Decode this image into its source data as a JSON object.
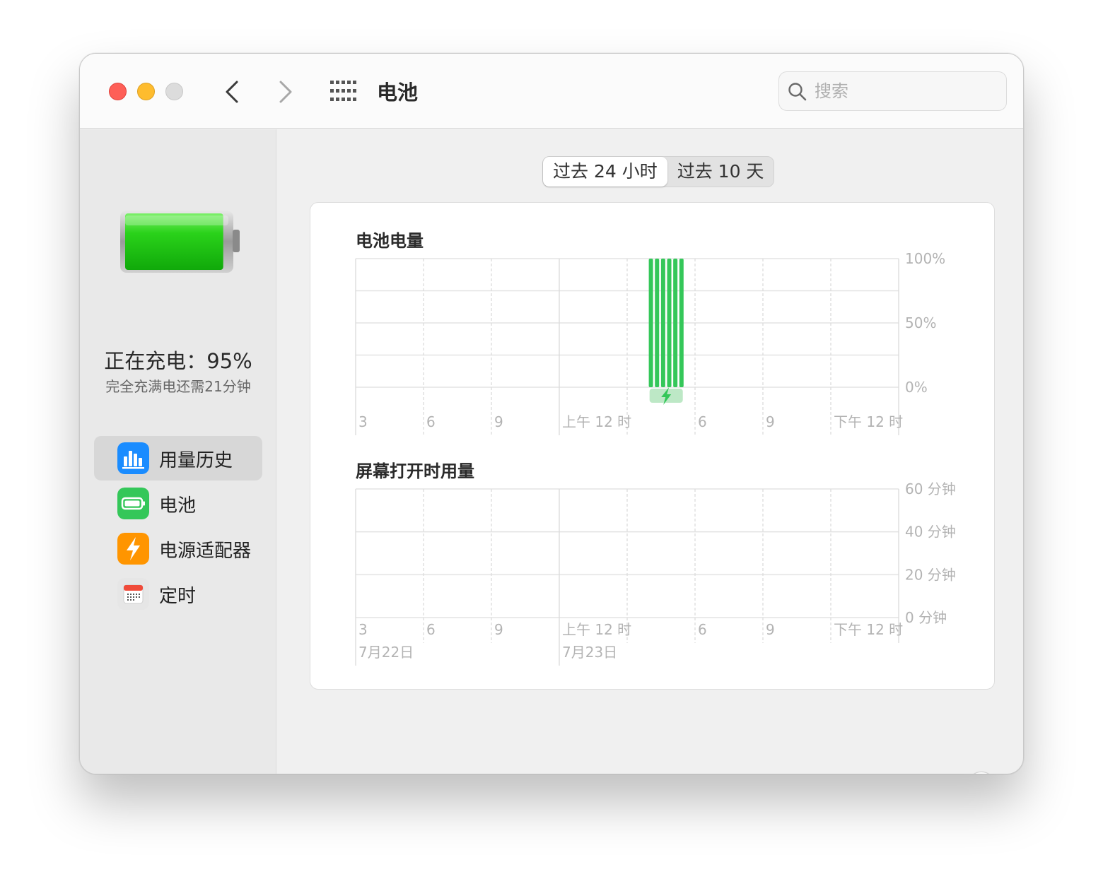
{
  "window": {
    "title": "电池",
    "search_placeholder": "搜索"
  },
  "sidebar": {
    "charge_status": "正在充电：95%",
    "charge_remaining": "完全充满电还需21分钟",
    "battery_level_fraction": 0.95,
    "items": [
      {
        "label": "用量历史",
        "icon": "bar-chart-icon",
        "color": "#1a8cff",
        "selected": true
      },
      {
        "label": "电池",
        "icon": "battery-icon",
        "color": "#34c759",
        "selected": false
      },
      {
        "label": "电源适配器",
        "icon": "bolt-icon",
        "color": "#ff9500",
        "selected": false
      },
      {
        "label": "定时",
        "icon": "calendar-icon",
        "color": "#e8e8e8",
        "selected": false
      }
    ]
  },
  "tabs": [
    {
      "label": "过去 24 小时",
      "active": true
    },
    {
      "label": "过去 10 天",
      "active": false
    }
  ],
  "help_label": "?",
  "chart_data": [
    {
      "type": "bar",
      "title": "电池电量",
      "x_tick_labels": [
        "3",
        "6",
        "9",
        "上午 12 时",
        "",
        "6",
        "9",
        "下午 12 时"
      ],
      "y_tick_labels": [
        "100%",
        "50%",
        "0%"
      ],
      "ylim": [
        0,
        100
      ],
      "bar_color": "#34c759",
      "charging_indicator_color": "#bde8c6",
      "bars": [
        {
          "slot": 4.35,
          "value": 100
        },
        {
          "slot": 4.44,
          "value": 100
        },
        {
          "slot": 4.53,
          "value": 100
        },
        {
          "slot": 4.62,
          "value": 100
        },
        {
          "slot": 4.71,
          "value": 100
        },
        {
          "slot": 4.8,
          "value": 100
        }
      ],
      "charging_span": [
        4.33,
        4.82
      ]
    },
    {
      "type": "bar",
      "title": "屏幕打开时用量",
      "x_tick_labels": [
        "3",
        "6",
        "9",
        "上午 12 时",
        "",
        "6",
        "9",
        "下午 12 时"
      ],
      "date_labels": [
        "7月22日",
        "",
        "",
        "7月23日",
        "",
        "",
        "",
        ""
      ],
      "y_tick_labels": [
        "60 分钟",
        "40 分钟",
        "20 分钟",
        "0 分钟"
      ],
      "ylim": [
        0,
        60
      ],
      "bars": []
    }
  ]
}
